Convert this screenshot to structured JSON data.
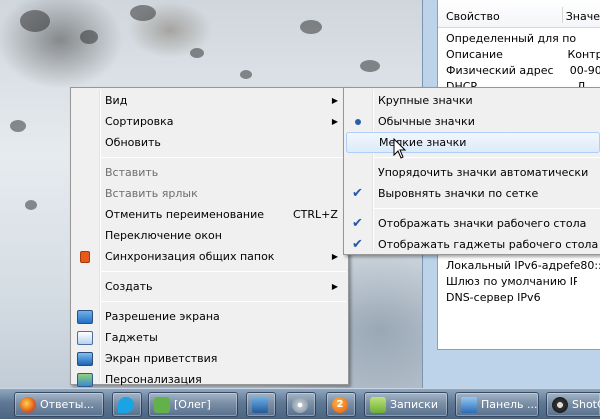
{
  "properties_panel": {
    "headers": [
      "Свойство",
      "Значе"
    ],
    "rows_top": [
      [
        "Определенный для по...",
        ""
      ],
      [
        "Описание",
        "Контр"
      ],
      [
        "Физический адрес",
        "00-90"
      ],
      [
        "DHCP",
        "Д"
      ]
    ],
    "rows_bottom": [
      [
        "Локальный IPv6-адрес...",
        "fe80::"
      ],
      [
        "Шлюз по умолчанию IP...",
        ""
      ],
      [
        "DNS-сервер IPv6",
        ""
      ]
    ]
  },
  "context_menu": {
    "items": [
      {
        "label": "Вид",
        "submenu": true
      },
      {
        "label": "Сортировка",
        "submenu": true
      },
      {
        "label": "Обновить"
      },
      {
        "separator": true
      },
      {
        "label": "Вставить",
        "disabled": true
      },
      {
        "label": "Вставить ярлык",
        "disabled": true
      },
      {
        "label": "Отменить переименование",
        "shortcut": "CTRL+Z"
      },
      {
        "label": "Переключение окон"
      },
      {
        "label": "Синхронизация общих папок",
        "submenu": true,
        "icon": "sync-icon"
      },
      {
        "separator": true
      },
      {
        "label": "Создать",
        "submenu": true
      },
      {
        "separator": true
      },
      {
        "label": "Разрешение экрана",
        "icon": "screen-resolution-icon"
      },
      {
        "label": "Гаджеты",
        "icon": "gadgets-icon"
      },
      {
        "label": "Экран приветствия",
        "icon": "welcome-screen-icon"
      },
      {
        "label": "Персонализация",
        "icon": "personalization-icon"
      }
    ]
  },
  "view_submenu": {
    "items": [
      {
        "label": "Крупные значки"
      },
      {
        "label": "Обычные значки",
        "mark": "radio"
      },
      {
        "label": "Мелкие значки",
        "highlighted": true
      },
      {
        "separator": true
      },
      {
        "label": "Упорядочить значки автоматически"
      },
      {
        "label": "Выровнять значки по сетке",
        "mark": "check"
      },
      {
        "separator": true
      },
      {
        "label": "Отображать значки рабочего стола",
        "mark": "check"
      },
      {
        "label": "Отображать гаджеты  рабочего стола",
        "mark": "check"
      }
    ]
  },
  "taskbar": {
    "buttons": [
      {
        "label": "Ответы...",
        "icon": "firefox-icon"
      },
      {
        "label": "",
        "icon": "skype-icon"
      },
      {
        "label": "[Олег]",
        "icon": "chat-icon"
      },
      {
        "label": "",
        "icon": "monitor-icon"
      },
      {
        "label": "",
        "icon": "disc-icon"
      },
      {
        "label": "",
        "icon": "orange-2-icon",
        "glyph": "2"
      },
      {
        "label": "Записки",
        "icon": "notes-icon"
      },
      {
        "label": "Панель ...",
        "icon": "control-panel-icon"
      },
      {
        "label": "ShotC",
        "icon": "shot-icon"
      }
    ]
  },
  "colors": {
    "menu_bg": "#f0f0f0",
    "highlight": "#dceaf9",
    "check": "#2457a7",
    "taskbar": "#5f7894"
  }
}
